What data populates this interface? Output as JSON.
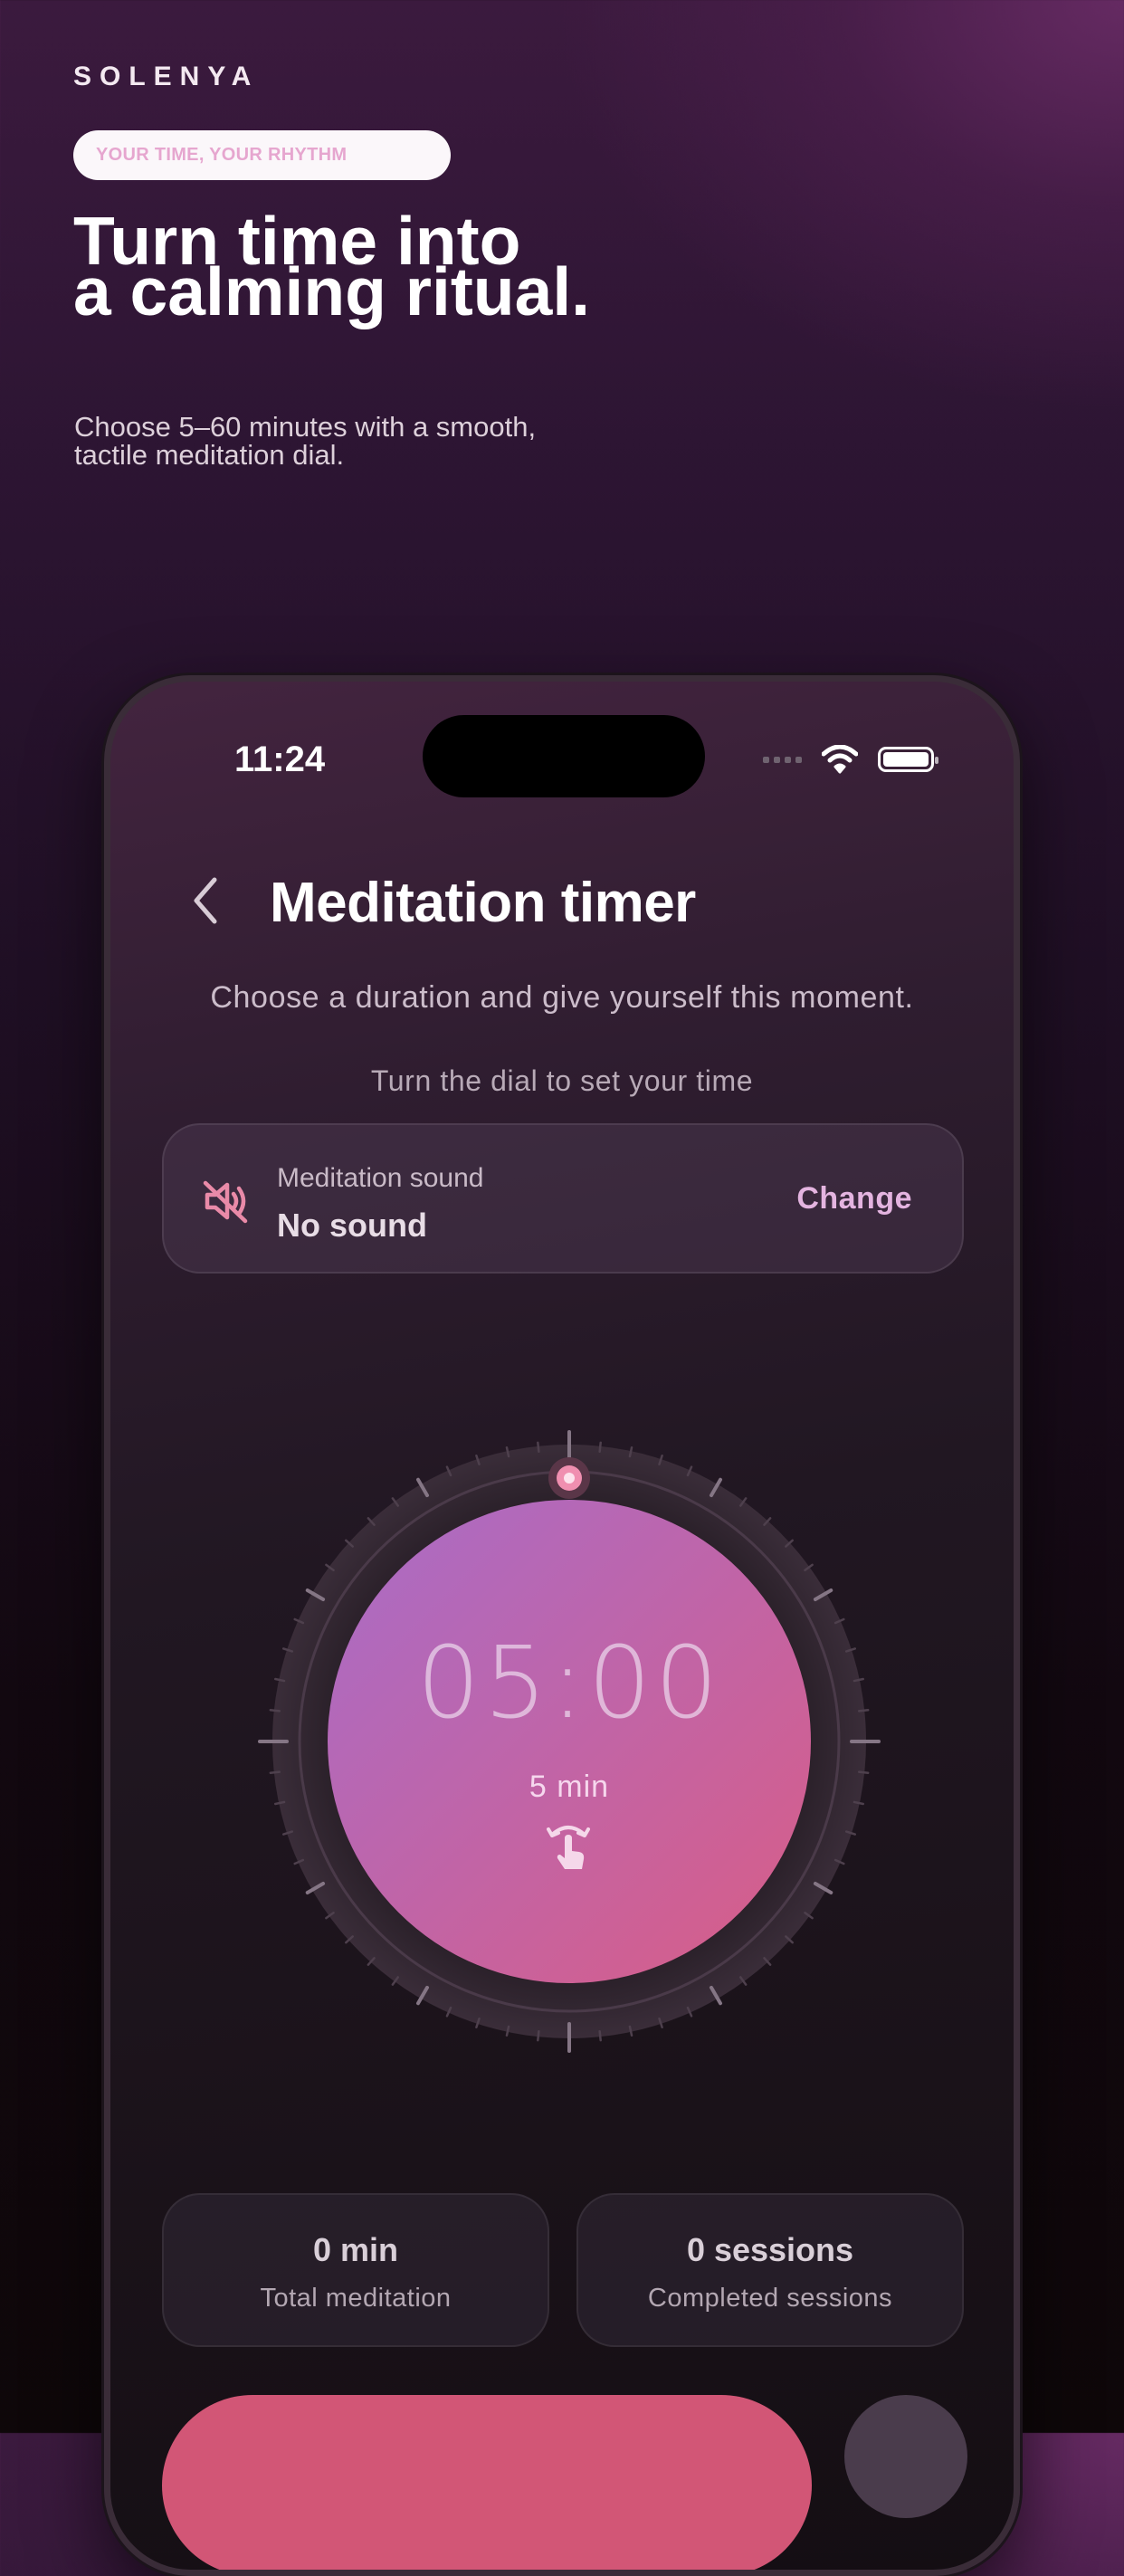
{
  "marketing": {
    "brand": "SOLENYA",
    "tagline": "YOUR TIME, YOUR RHYTHM",
    "headline_line1": "Turn time into",
    "headline_line2": "a calming ritual.",
    "subline_line1": "Choose 5–60 minutes with a smooth,",
    "subline_line2": "tactile meditation dial."
  },
  "status_bar": {
    "time": "11:24",
    "icons": [
      "cellular-signal-icon",
      "wifi-icon",
      "battery-icon"
    ]
  },
  "screen": {
    "back_icon": "chevron-left-icon",
    "title": "Meditation timer",
    "description": "Choose a duration and give yourself this moment.",
    "dial_hint": "Turn the dial to set your time"
  },
  "sound": {
    "icon": "speaker-muted-icon",
    "label": "Meditation sound",
    "value": "No sound",
    "action": "Change"
  },
  "dial": {
    "display_time": "05:00",
    "minutes_label": "5 min",
    "selected_minutes": 5,
    "range_minutes": [
      0,
      60
    ],
    "gesture_icon": "hand-rotate-icon"
  },
  "stats": [
    {
      "value": "0 min",
      "label": "Total meditation"
    },
    {
      "value": "0 sessions",
      "label": "Completed sessions"
    }
  ],
  "colors": {
    "accent_pink": "#d25676",
    "dial_gradient_start": "#a86cc8",
    "dial_gradient_end": "#d95d86",
    "action_text": "#e4b4e0",
    "muted_icon": "#e98aa8"
  }
}
